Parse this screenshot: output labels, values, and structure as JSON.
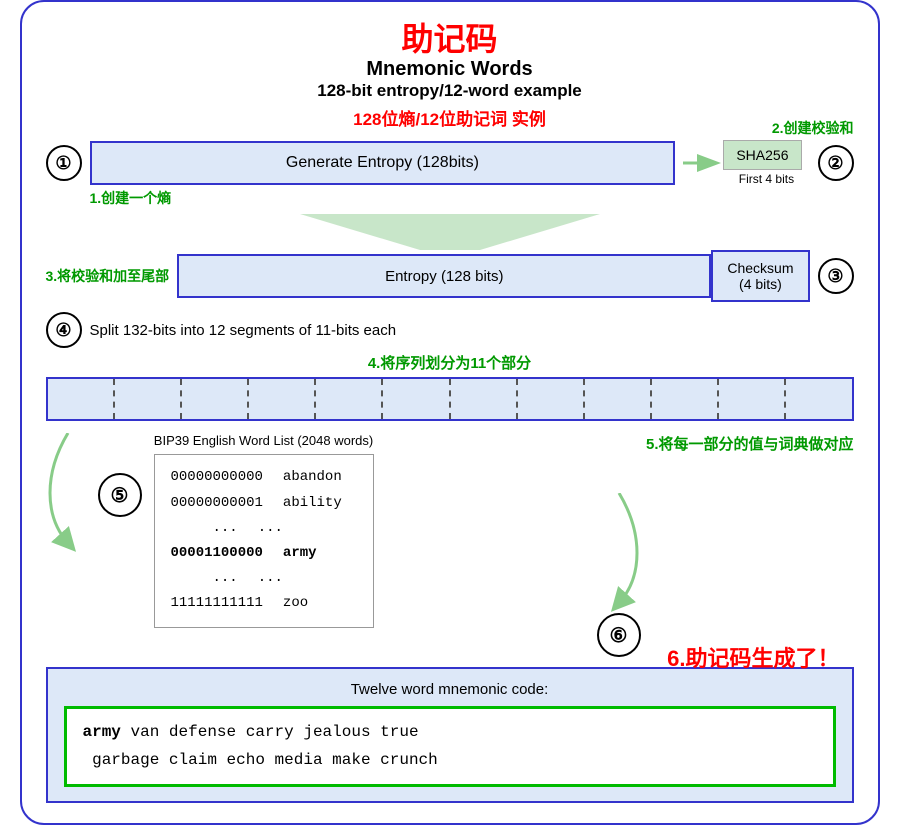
{
  "title": {
    "zh": "助记码",
    "en1": "Mnemonic Words",
    "en2": "128-bit entropy/12-word example",
    "zh2": "128位熵/12位助记词 实例"
  },
  "step2_label": "2.创建校验和",
  "step1": {
    "circle": "①",
    "box_text": "Generate Entropy (128bits)",
    "sha_label": "SHA256",
    "first4bits": "First 4 bits",
    "circle2": "②",
    "label_zh": "1.创建一个熵"
  },
  "step3": {
    "label_zh": "3.将校验和加至尾部",
    "entropy_text": "Entropy (128 bits)",
    "checksum_text": "Checksum\n(4 bits)",
    "circle": "③"
  },
  "step4": {
    "circle": "④",
    "text": "Split 132-bits into 12 segments of 11-bits each",
    "label_zh": "4.将序列划分为11个部分",
    "segments": 12
  },
  "step5": {
    "circle": "⑤",
    "dict_title": "BIP39 English Word List (2048 words)",
    "dict_rows": [
      {
        "left": "00000000000",
        "right": "abandon"
      },
      {
        "left": "00000000001",
        "right": "ability"
      },
      {
        "left": "...",
        "right": "..."
      },
      {
        "left": "00001100000",
        "right": "army",
        "bold": true
      },
      {
        "left": "...",
        "right": "..."
      },
      {
        "left": "11111111111",
        "right": "zoo"
      }
    ],
    "label_zh": "5.将每一部分的值与词典做对应",
    "circle6": "⑥"
  },
  "step6": {
    "label_zh": "6.助记码生成了！",
    "title": "Twelve word mnemonic code:",
    "mnemonic_bold": "army",
    "mnemonic_rest": " van defense carry jealous true\ngarbage claim echo media make crunch"
  }
}
